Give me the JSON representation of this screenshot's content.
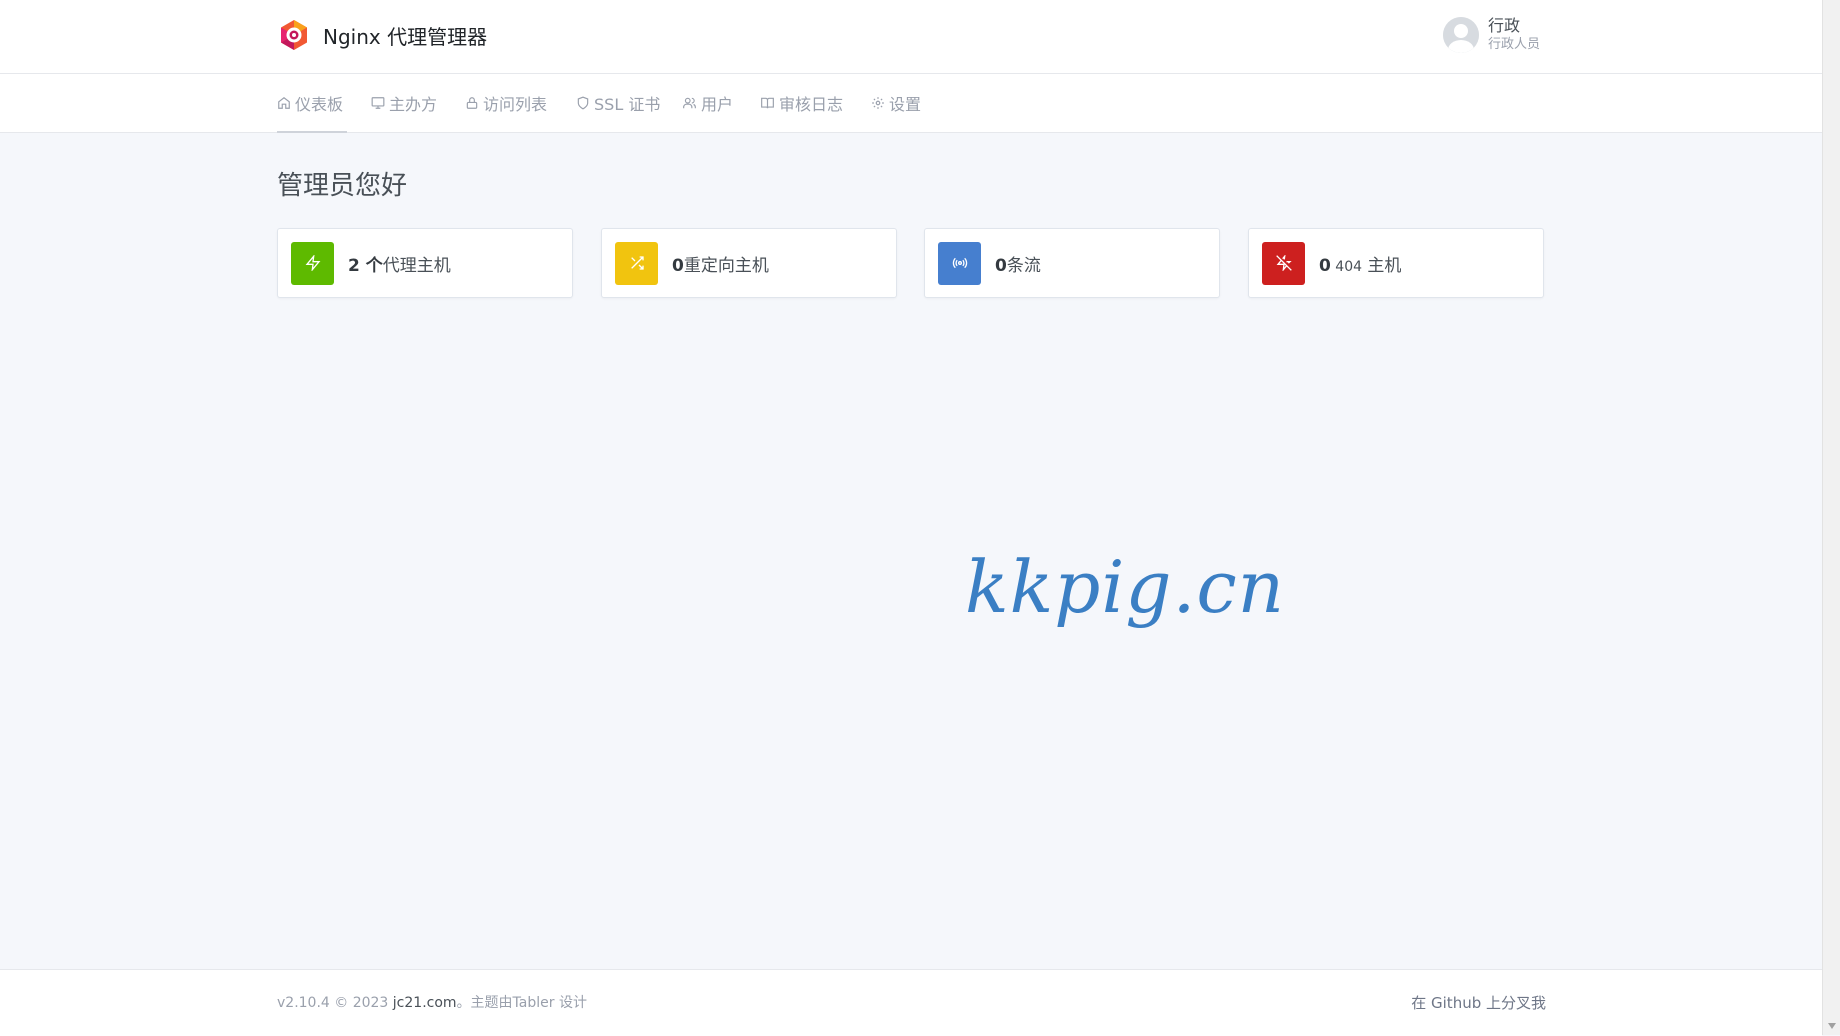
{
  "header": {
    "brand_name": "Nginx 代理管理器",
    "user_name": "行政",
    "user_role": "行政人员"
  },
  "nav": {
    "items": [
      {
        "label": "仪表板",
        "icon": "home-icon"
      },
      {
        "label": "主办方",
        "icon": "monitor-icon"
      },
      {
        "label": "访问列表",
        "icon": "lock-icon"
      },
      {
        "label": "SSL 证书",
        "icon": "shield-icon"
      },
      {
        "label": "用户",
        "icon": "users-icon"
      },
      {
        "label": "审核日志",
        "icon": "book-icon"
      },
      {
        "label": "设置",
        "icon": "gear-icon"
      }
    ]
  },
  "main": {
    "title": "管理员您好",
    "cards": [
      {
        "count": "2",
        "label_bold": " 个",
        "label": "代理主机",
        "color": "#5eba00",
        "icon": "zap-icon"
      },
      {
        "count": "0",
        "label": "重定向主机",
        "color": "#f1c40f",
        "icon": "shuffle-icon"
      },
      {
        "count": "0",
        "label": "条流",
        "color": "#467fcf",
        "icon": "radio-icon"
      },
      {
        "count": "0",
        "label_small": " 404",
        "label": " 主机",
        "color": "#cd201f",
        "icon": "zap-off-icon"
      }
    ]
  },
  "watermark": "kkpig.cn",
  "footer": {
    "version": "v2.10.4 © 2023 ",
    "link": "jc21.com",
    "suffix": "。主题由Tabler 设计",
    "right": "在 Github 上分叉我"
  }
}
